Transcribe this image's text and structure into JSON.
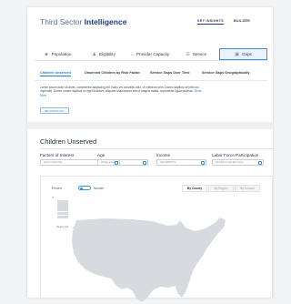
{
  "header": {
    "brand_light": "Third Sector",
    "brand_bold": "Intelligence",
    "nav": [
      "KEY INSIGHTS",
      "BUILDER"
    ]
  },
  "tabs": [
    {
      "label": "Population",
      "icon": "people-icon"
    },
    {
      "label": "Eligibility",
      "icon": "person-check-icon"
    },
    {
      "label": "Provider Capacity",
      "icon": "building-icon"
    },
    {
      "label": "Service",
      "icon": "list-icon"
    },
    {
      "label": "Gaps",
      "icon": "gaps-icon"
    }
  ],
  "subtabs": [
    "Children Unserved",
    "Unserved Children by Risk Factor",
    "Service Gaps Over Time",
    "Service Gaps Geographically"
  ],
  "description": {
    "text": "Lorem ipsum dolor sit amet, consectetur adipiscing elit. Nunc vel convallis odio, ut interdum sem. Donec dapibus vel elit non imperdiet. Donec ornare dapibus ex eget tincidunt. Aliquam ullamcorper nisi ut magna mattis, at pharetra ligula pulvinar.",
    "more": "Show More"
  },
  "methodology_label": "METHODOLOGY",
  "section": {
    "title": "Children Unserved",
    "export_label": "EXPORT"
  },
  "filters": [
    {
      "label": "Factors of Interest",
      "value": "Family Child Care"
    },
    {
      "label": "Age",
      "value": "All Age Groups"
    },
    {
      "label": "Income",
      "value": "100-199% FPL"
    },
    {
      "label": "Labor Force Participation",
      "value": "All adults in the labor force"
    }
  ],
  "map": {
    "toggle_left": "Percent",
    "toggle_right": "Number",
    "segments": [
      "By County",
      "By Region",
      "By Census"
    ],
    "zoom_in": "+",
    "zoom_out": "−",
    "legend_caption": "Region info",
    "legend_arrow": "→"
  },
  "colors": {
    "brand": "#1c3d8f",
    "accent": "#3b8fe0",
    "map_fill": "#d7dbe0"
  }
}
